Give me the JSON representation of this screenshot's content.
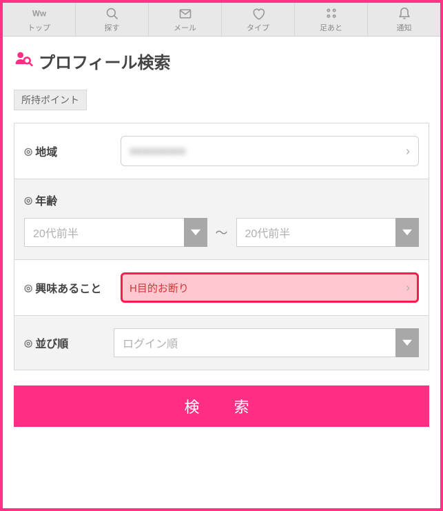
{
  "nav": {
    "items": [
      {
        "label": "トップ",
        "icon": "logo"
      },
      {
        "label": "探す",
        "icon": "search"
      },
      {
        "label": "メール",
        "icon": "mail"
      },
      {
        "label": "タイプ",
        "icon": "heart"
      },
      {
        "label": "足あと",
        "icon": "footprint"
      },
      {
        "label": "通知",
        "icon": "bell"
      }
    ]
  },
  "page": {
    "title": "プロフィール検索"
  },
  "points": {
    "label": "所持ポイント"
  },
  "form": {
    "region": {
      "label": "地域",
      "value_obscured": "■■■■■■■■■"
    },
    "age": {
      "label": "年齢",
      "from_placeholder": "20代前半",
      "separator": "〜",
      "to_placeholder": "20代前半"
    },
    "interest": {
      "label": "興味あること",
      "value": "H目的お断り"
    },
    "sort": {
      "label": "並び順",
      "placeholder": "ログイン順"
    },
    "submit": "検　索"
  },
  "colors": {
    "accent": "#ff2d84",
    "frame": "#ff3385",
    "highlight_border": "#ff1a4d",
    "highlight_bg": "#ffc7cf"
  }
}
